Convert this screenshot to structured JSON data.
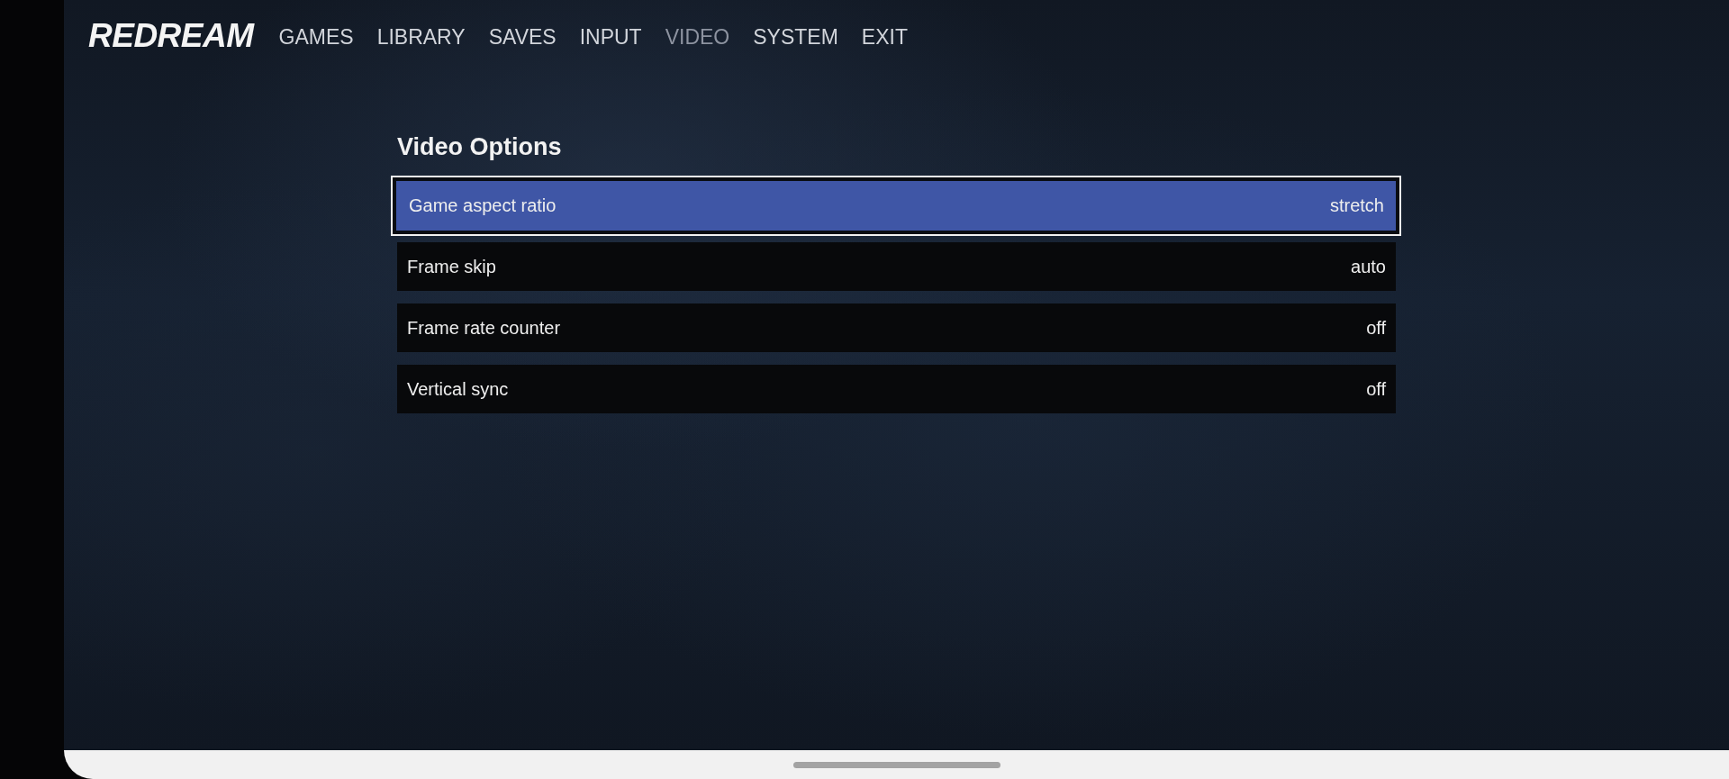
{
  "nav": {
    "logo": "REDREAM",
    "items": [
      {
        "label": "GAMES",
        "selected": false
      },
      {
        "label": "LIBRARY",
        "selected": false
      },
      {
        "label": "SAVES",
        "selected": false
      },
      {
        "label": "INPUT",
        "selected": false
      },
      {
        "label": "VIDEO",
        "selected": true
      },
      {
        "label": "SYSTEM",
        "selected": false
      },
      {
        "label": "EXIT",
        "selected": false
      }
    ]
  },
  "panel": {
    "title": "Video Options",
    "options": [
      {
        "label": "Game aspect ratio",
        "value": "stretch",
        "selected": true
      },
      {
        "label": "Frame skip",
        "value": "auto",
        "selected": false
      },
      {
        "label": "Frame rate counter",
        "value": "off",
        "selected": false
      },
      {
        "label": "Vertical sync",
        "value": "off",
        "selected": false
      }
    ]
  }
}
